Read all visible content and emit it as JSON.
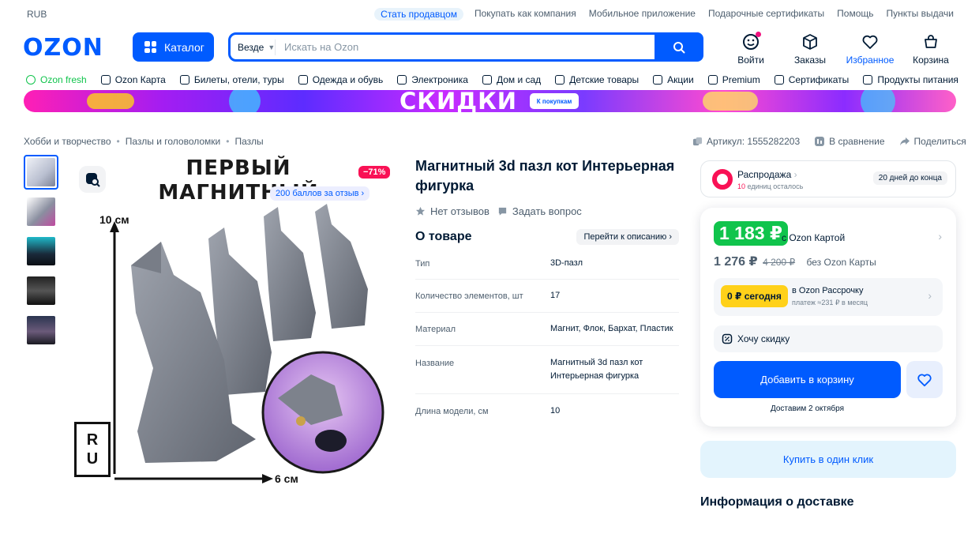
{
  "topbar": {
    "currency": "RUB",
    "links": [
      "Стать продавцом",
      "Покупать как компания",
      "Мобильное приложение",
      "Подарочные сертификаты",
      "Помощь",
      "Пункты выдачи"
    ]
  },
  "header": {
    "logo": "OZON",
    "catalog_label": "Каталог",
    "search_scope": "Везде",
    "search_placeholder": "Искать на Ozon",
    "actions": [
      {
        "label": "Войти",
        "icon": "user-icon"
      },
      {
        "label": "Заказы",
        "icon": "box-icon"
      },
      {
        "label": "Избранное",
        "icon": "heart-icon"
      },
      {
        "label": "Корзина",
        "icon": "cart-icon"
      }
    ]
  },
  "nav": [
    "Ozon fresh",
    "Ozon Карта",
    "Билеты, отели, туры",
    "Одежда и обувь",
    "Электроника",
    "Дом и сад",
    "Детские товары",
    "Акции",
    "Premium",
    "Сертификаты",
    "Продукты питания"
  ],
  "banner": {
    "title": "СКИДКИ",
    "tag": "К покупкам"
  },
  "breadcrumbs": [
    "Хобби и творчество",
    "Пазлы и головоломки",
    "Пазлы"
  ],
  "gallery": {
    "headline_1": "ПЕРВЫЙ",
    "headline_2": "МАГНИТНЫЙ",
    "discount": "−71%",
    "bonus": "200 баллов за отзыв",
    "dim_height": "10 см",
    "dim_width": "6 см",
    "brand_mark_1": "R",
    "brand_mark_2": "U"
  },
  "product": {
    "title": "Магнитный 3d пазл кот Интерьерная фигурка",
    "reviews": "Нет отзывов",
    "ask": "Задать вопрос",
    "about_title": "О товаре",
    "goto_desc": "Перейти к описанию",
    "specs": [
      {
        "k": "Тип",
        "v": "3D-пазл"
      },
      {
        "k": "Количество элементов, шт",
        "v": "17"
      },
      {
        "k": "Материал",
        "v": "Магнит, Флок, Бархат, Пластик"
      },
      {
        "k": "Название",
        "v": "Магнитный 3d пазл кот Интерьерная фигурка"
      },
      {
        "k": "Длина модели, см",
        "v": "10"
      }
    ]
  },
  "meta_right": {
    "article": "Артикул: 1555282203",
    "compare": "В сравнение",
    "share": "Поделиться"
  },
  "sale": {
    "title": "Распродажа",
    "left_count": "10",
    "left_text": "единиц осталось",
    "days": "20 дней до конца"
  },
  "price": {
    "card_price": "1 183 ₽",
    "card_label": "с Ozon Картой",
    "regular": "1 276 ₽",
    "old": "4 200 ₽",
    "regular_label": "без Ozon Карты",
    "installment_today": "0 ₽ сегодня",
    "installment_label": "в Ozon Рассрочку",
    "installment_sub": "платеж ≈231 ₽ в месяц",
    "want_discount": "Хочу скидку",
    "add_to_cart": "Добавить в корзину",
    "delivery": "Доставим 2 октября",
    "one_click": "Купить в один клик"
  },
  "delivery_info_title": "Информация о доставке",
  "colors": {
    "brand": "#005bff",
    "green": "#10c44c",
    "sale": "#f91155",
    "yellow": "#ffd11a"
  }
}
